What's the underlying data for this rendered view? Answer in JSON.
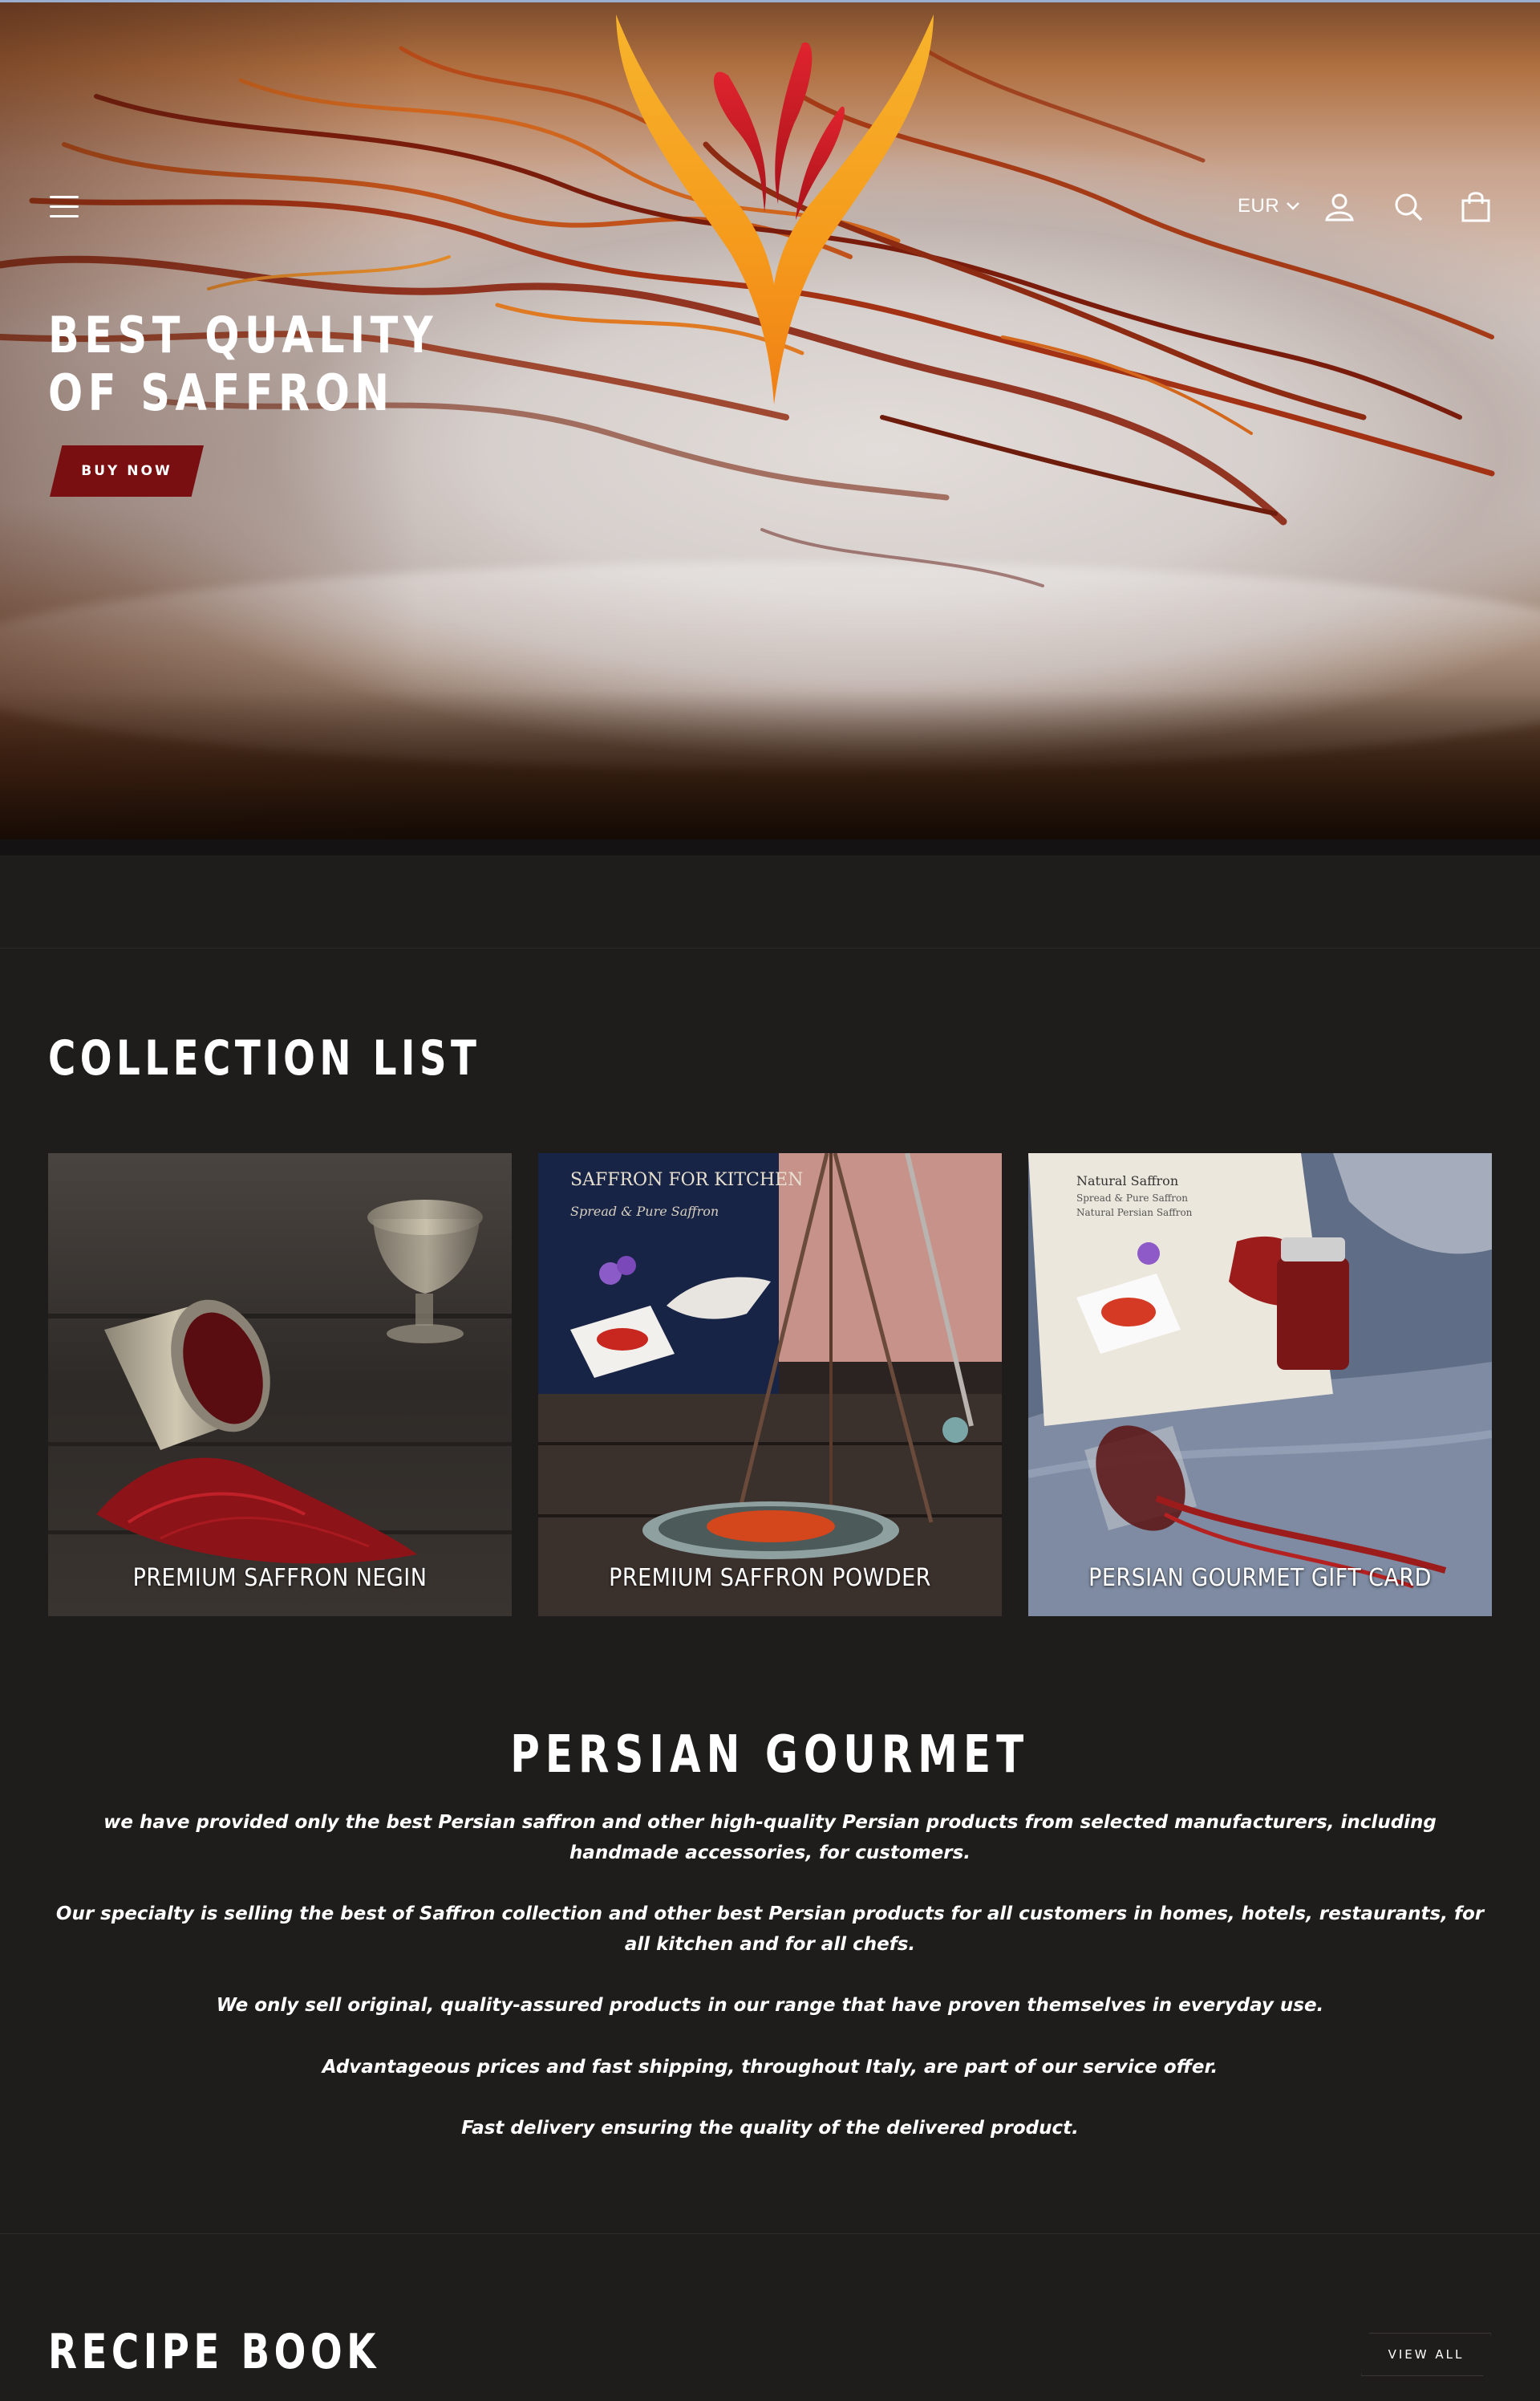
{
  "header": {
    "currency": "EUR",
    "icons": [
      "menu-icon",
      "account-icon",
      "search-icon",
      "cart-icon"
    ]
  },
  "hero": {
    "title_line1": "BEST QUALITY",
    "title_line2": "OF SAFFRON",
    "button_label": "BUY NOW"
  },
  "collection": {
    "title": "COLLECTION LIST",
    "items": [
      {
        "label": "PREMIUM SAFFRON NEGIN"
      },
      {
        "label": "PREMIUM SAFFRON POWDER"
      },
      {
        "label": "PERSIAN GOURMET GIFT CARD"
      }
    ]
  },
  "about": {
    "title": "PERSIAN GOURMET",
    "paragraphs": [
      "we have provided only the best Persian saffron and other high-quality Persian products from selected manufacturers, including handmade accessories, for customers.",
      "Our specialty is selling the best of Saffron collection and other best Persian products for all customers in homes, hotels, restaurants, for all kitchen and for all chefs.",
      "We only sell original, quality-assured products in our range that have proven themselves in everyday use.",
      "Advantageous prices and fast shipping, throughout Italy, are part of our service offer.",
      "Fast delivery ensuring the quality of the delivered product."
    ]
  },
  "recipes": {
    "title": "RECIPE BOOK",
    "view_all_label": "VIEW ALL"
  },
  "colors": {
    "background": "#1f1c1c",
    "accent_button": "#7a0f12",
    "logo_gold": "#f5a623",
    "logo_red": "#d91e2a"
  }
}
